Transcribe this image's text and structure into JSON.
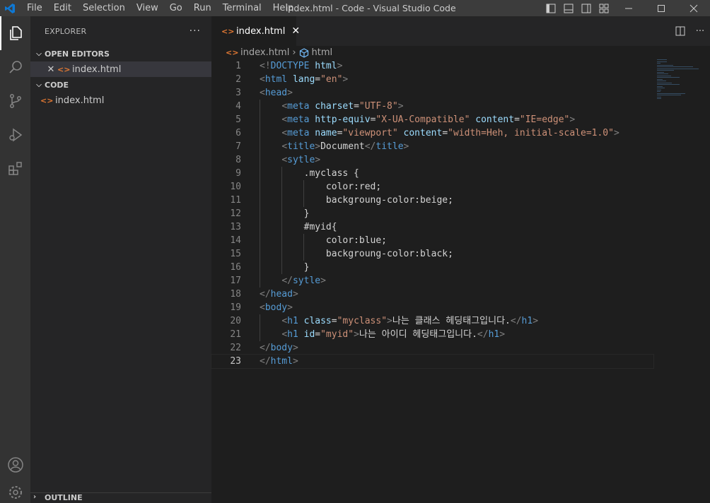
{
  "titlebar": {
    "menu": [
      "File",
      "Edit",
      "Selection",
      "View",
      "Go",
      "Run",
      "Terminal",
      "Help"
    ],
    "window_title": "index.html - Code - Visual Studio Code"
  },
  "sidebar": {
    "title": "EXPLORER",
    "open_editors_label": "OPEN EDITORS",
    "open_editor_file": "index.html",
    "folder_label": "CODE",
    "folder_file": "index.html",
    "outline_label": "OUTLINE"
  },
  "editor": {
    "tab_label": "index.html",
    "breadcrumb_file": "index.html",
    "breadcrumb_symbol": "html",
    "current_line": 23,
    "lines": [
      [
        [
          "br",
          "<!"
        ],
        [
          "tag",
          "DOCTYPE"
        ],
        [
          "txt",
          " "
        ],
        [
          "attr",
          "html"
        ],
        [
          "br",
          ">"
        ]
      ],
      [
        [
          "br",
          "<"
        ],
        [
          "tag",
          "html"
        ],
        [
          "txt",
          " "
        ],
        [
          "attr",
          "lang"
        ],
        [
          "txt",
          "="
        ],
        [
          "str",
          "\"en\""
        ],
        [
          "br",
          ">"
        ]
      ],
      [
        [
          "br",
          "<"
        ],
        [
          "tag",
          "head"
        ],
        [
          "br",
          ">"
        ]
      ],
      [
        [
          "txt",
          "    "
        ],
        [
          "br",
          "<"
        ],
        [
          "tag",
          "meta"
        ],
        [
          "txt",
          " "
        ],
        [
          "attr",
          "charset"
        ],
        [
          "txt",
          "="
        ],
        [
          "str",
          "\"UTF-8\""
        ],
        [
          "br",
          ">"
        ]
      ],
      [
        [
          "txt",
          "    "
        ],
        [
          "br",
          "<"
        ],
        [
          "tag",
          "meta"
        ],
        [
          "txt",
          " "
        ],
        [
          "attr",
          "http-equiv"
        ],
        [
          "txt",
          "="
        ],
        [
          "str",
          "\"X-UA-Compatible\""
        ],
        [
          "txt",
          " "
        ],
        [
          "attr",
          "content"
        ],
        [
          "txt",
          "="
        ],
        [
          "str",
          "\"IE=edge\""
        ],
        [
          "br",
          ">"
        ]
      ],
      [
        [
          "txt",
          "    "
        ],
        [
          "br",
          "<"
        ],
        [
          "tag",
          "meta"
        ],
        [
          "txt",
          " "
        ],
        [
          "attr",
          "name"
        ],
        [
          "txt",
          "="
        ],
        [
          "str",
          "\"viewport\""
        ],
        [
          "txt",
          " "
        ],
        [
          "attr",
          "content"
        ],
        [
          "txt",
          "="
        ],
        [
          "str",
          "\"width=Heh, initial-scale=1.0\""
        ],
        [
          "br",
          ">"
        ]
      ],
      [
        [
          "txt",
          "    "
        ],
        [
          "br",
          "<"
        ],
        [
          "tag",
          "title"
        ],
        [
          "br",
          ">"
        ],
        [
          "txt",
          "Document"
        ],
        [
          "br",
          "</"
        ],
        [
          "tag",
          "title"
        ],
        [
          "br",
          ">"
        ]
      ],
      [
        [
          "txt",
          "    "
        ],
        [
          "br",
          "<"
        ],
        [
          "tag",
          "sytle"
        ],
        [
          "br",
          ">"
        ]
      ],
      [
        [
          "txt",
          "        .myclass {"
        ]
      ],
      [
        [
          "txt",
          "            color:red;"
        ]
      ],
      [
        [
          "txt",
          "            backgroung-color:beige;"
        ]
      ],
      [
        [
          "txt",
          "        }"
        ]
      ],
      [
        [
          "txt",
          "        #myid{"
        ]
      ],
      [
        [
          "txt",
          "            color:blue;"
        ]
      ],
      [
        [
          "txt",
          "            backgroung-color:black;"
        ]
      ],
      [
        [
          "txt",
          "        }"
        ]
      ],
      [
        [
          "txt",
          "    "
        ],
        [
          "br",
          "</"
        ],
        [
          "tag",
          "sytle"
        ],
        [
          "br",
          ">"
        ]
      ],
      [
        [
          "br",
          "</"
        ],
        [
          "tag",
          "head"
        ],
        [
          "br",
          ">"
        ]
      ],
      [
        [
          "br",
          "<"
        ],
        [
          "tag",
          "body"
        ],
        [
          "br",
          ">"
        ]
      ],
      [
        [
          "txt",
          "    "
        ],
        [
          "br",
          "<"
        ],
        [
          "tag",
          "h1"
        ],
        [
          "txt",
          " "
        ],
        [
          "attr",
          "class"
        ],
        [
          "txt",
          "="
        ],
        [
          "str",
          "\"myclass\""
        ],
        [
          "br",
          ">"
        ],
        [
          "txt",
          "나는 클래스 헤딩태그입니다."
        ],
        [
          "br",
          "</"
        ],
        [
          "tag",
          "h1"
        ],
        [
          "br",
          ">"
        ]
      ],
      [
        [
          "txt",
          "    "
        ],
        [
          "br",
          "<"
        ],
        [
          "tag",
          "h1"
        ],
        [
          "txt",
          " "
        ],
        [
          "attr",
          "id"
        ],
        [
          "txt",
          "="
        ],
        [
          "str",
          "\"myid\""
        ],
        [
          "br",
          ">"
        ],
        [
          "txt",
          "나는 아이디 헤딩태그입니다."
        ],
        [
          "br",
          "</"
        ],
        [
          "tag",
          "h1"
        ],
        [
          "br",
          ">"
        ]
      ],
      [
        [
          "br",
          "</"
        ],
        [
          "tag",
          "body"
        ],
        [
          "br",
          ">"
        ]
      ],
      [
        [
          "br",
          "</"
        ],
        [
          "tag",
          "html"
        ],
        [
          "br",
          ">"
        ]
      ]
    ]
  },
  "colors": {
    "titlebar_bg": "#3c3c3c",
    "activitybar_bg": "#333333",
    "sidebar_bg": "#252526",
    "editor_bg": "#1e1e1e",
    "tag": "#569cd6",
    "attr": "#9cdcfe",
    "string": "#ce9178",
    "bracket": "#808080",
    "file_icon": "#e37933"
  },
  "icons": {
    "activity": [
      "files-icon",
      "search-icon",
      "source-control-icon",
      "run-debug-icon",
      "extensions-icon"
    ],
    "activity_bottom": [
      "account-icon",
      "settings-gear-icon"
    ]
  }
}
